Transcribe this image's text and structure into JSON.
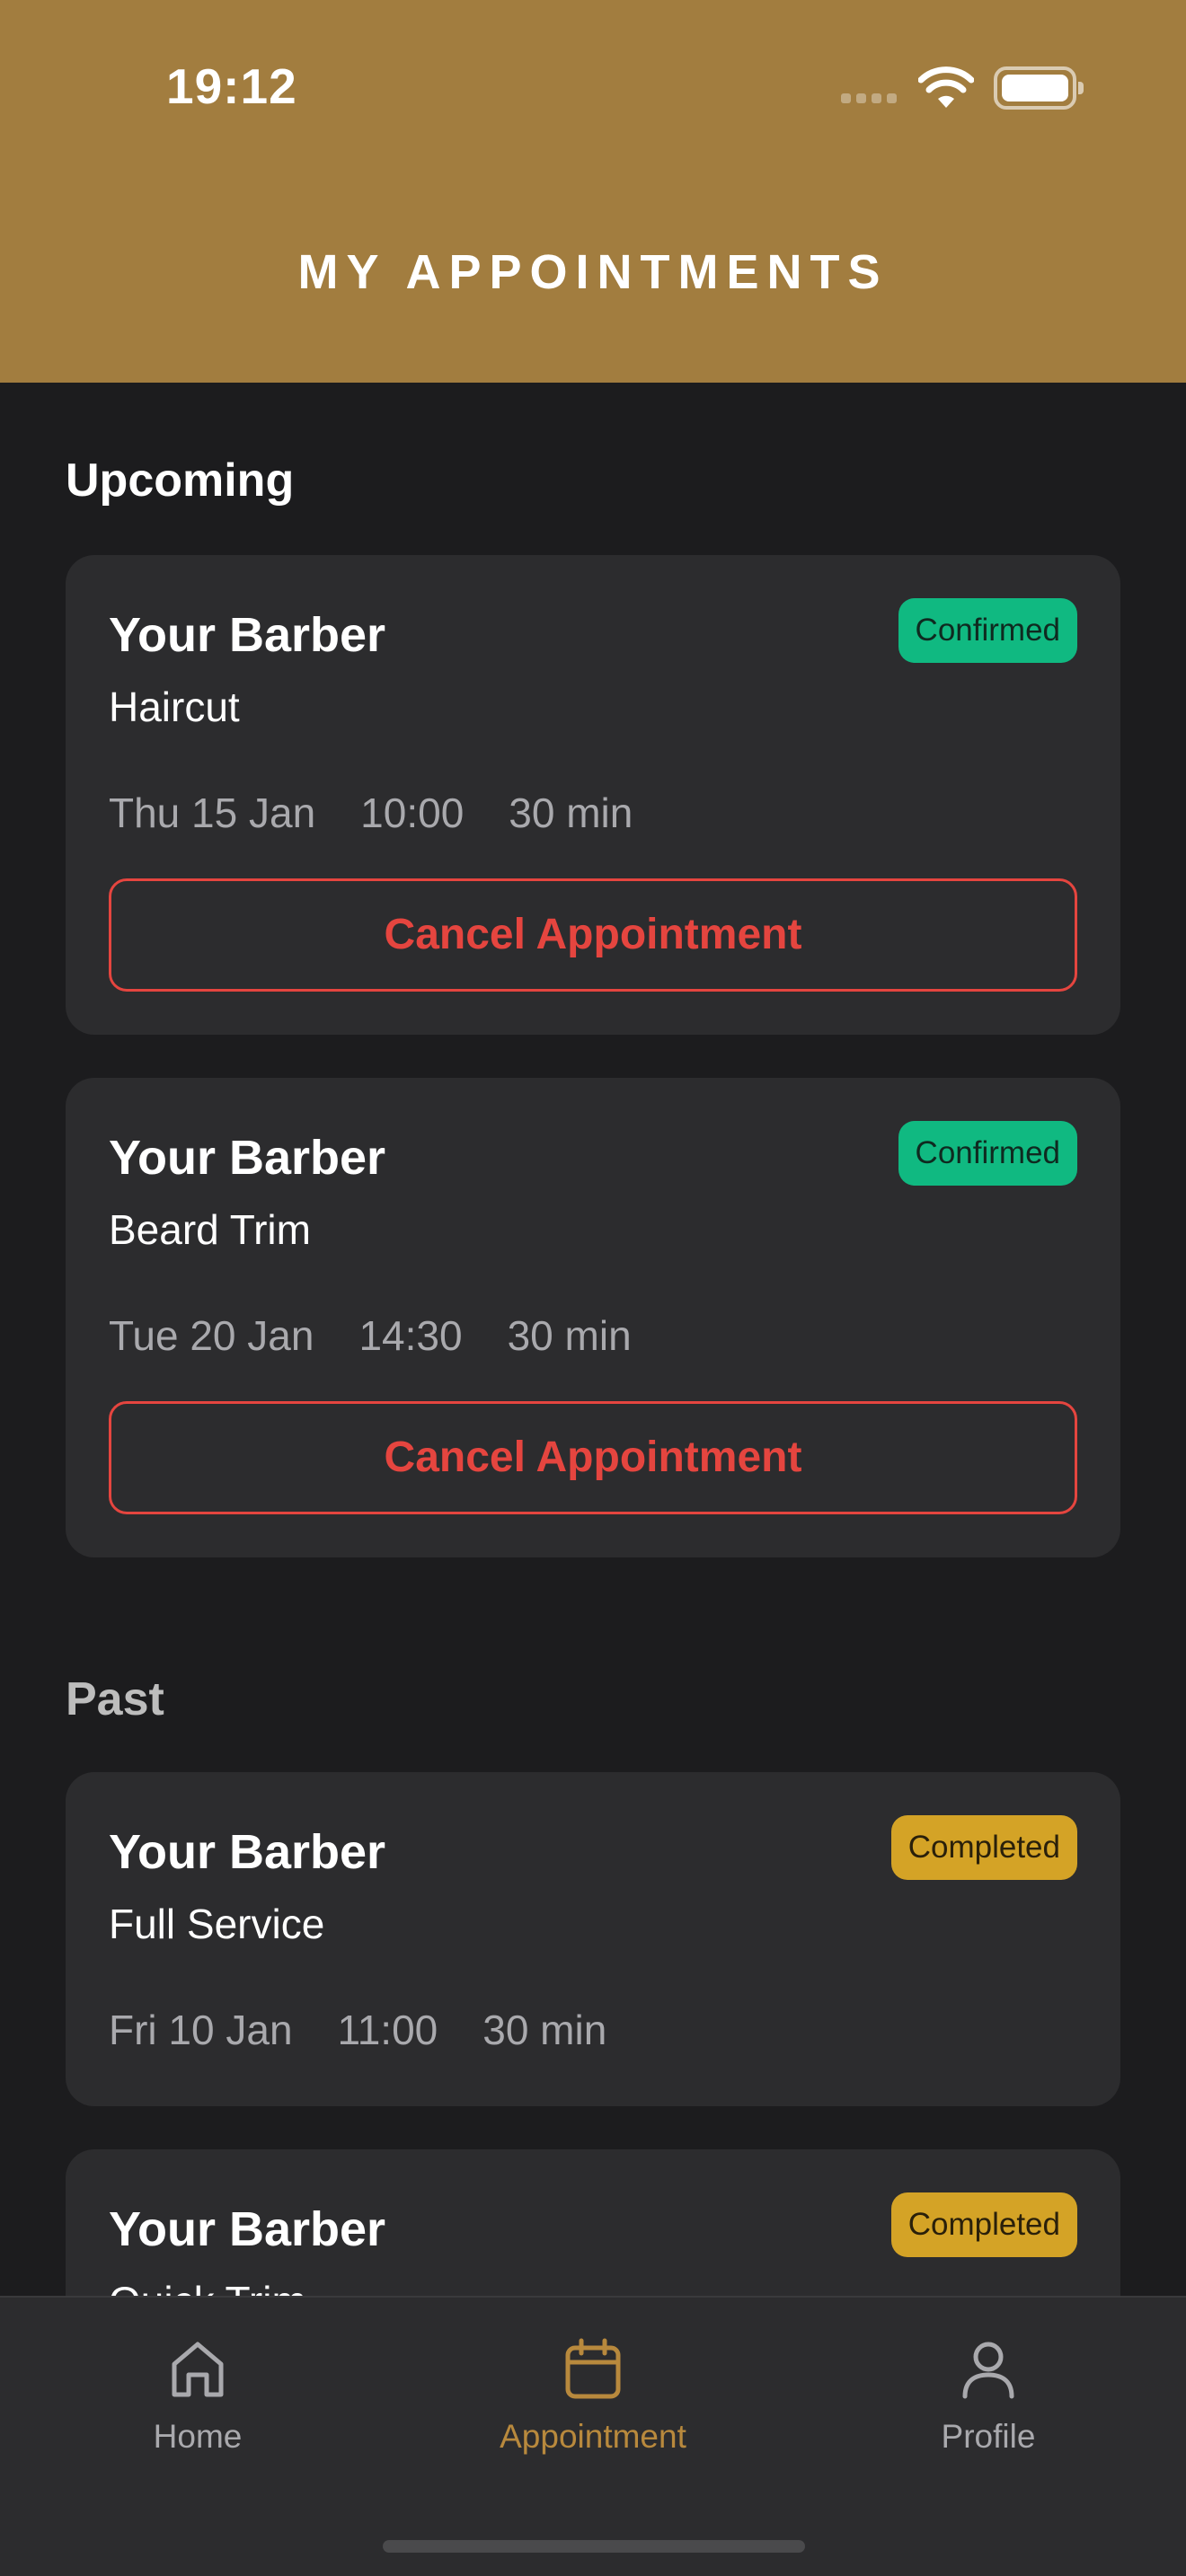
{
  "status_bar": {
    "time": "19:12"
  },
  "header": {
    "title": "MY APPOINTMENTS"
  },
  "sections": {
    "upcoming": "Upcoming",
    "past": "Past"
  },
  "upcoming": [
    {
      "barber": "Your Barber",
      "service": "Haircut",
      "date": "Thu 15 Jan",
      "time": "10:00",
      "duration": "30 min",
      "status": "Confirmed",
      "action": "Cancel Appointment"
    },
    {
      "barber": "Your Barber",
      "service": "Beard Trim",
      "date": "Tue 20 Jan",
      "time": "14:30",
      "duration": "30 min",
      "status": "Confirmed",
      "action": "Cancel Appointment"
    }
  ],
  "past": [
    {
      "barber": "Your Barber",
      "service": "Full Service",
      "date": "Fri 10 Jan",
      "time": "11:00",
      "duration": "30 min",
      "status": "Completed"
    },
    {
      "barber": "Your Barber",
      "service": "Quick Trim",
      "status": "Completed"
    }
  ],
  "tabbar": {
    "items": [
      {
        "label": "Home",
        "icon": "home-icon"
      },
      {
        "label": "Appointment",
        "icon": "calendar-icon",
        "active": true
      },
      {
        "label": "Profile",
        "icon": "person-icon"
      }
    ]
  },
  "colors": {
    "header": "#a27d3f",
    "accent": "#b8893d",
    "confirmed": "#10b981",
    "completed": "#d4a326",
    "danger": "#e5453f"
  }
}
